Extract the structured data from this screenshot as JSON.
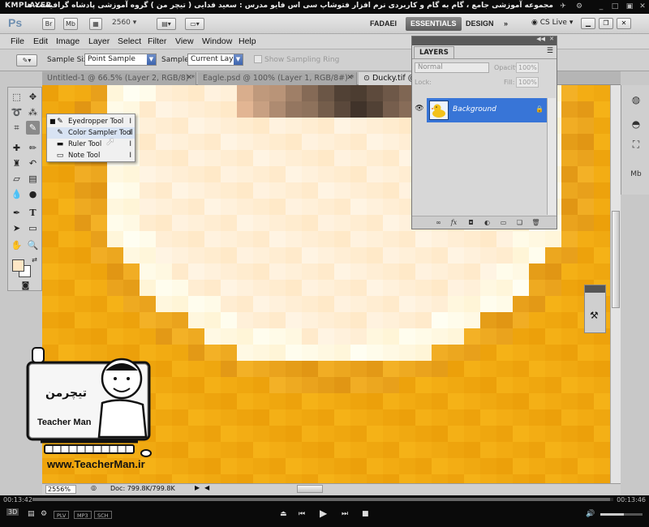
{
  "player": {
    "name": "KMPLAYER",
    "video_title": "مجموعه آموزشی جامع ، گام به گام و کاربردی نرم افزار فتوشاپ سی اس فایو   مدرس : سعید فدایی ( تیچر من ) گروه آموزشی پادشاه گرافیست ها",
    "time_current": "00:13:42",
    "time_total": "00:13:46",
    "progress_fraction": 0.995,
    "volume_fraction": 0.55,
    "tags": [
      "PLV",
      "MP3",
      "SCH"
    ],
    "badge_3d": "3D"
  },
  "ps": {
    "logo": "Ps",
    "appbar_icons": [
      "Br",
      "Mb"
    ],
    "zoom_level": "2560",
    "workspaces": [
      "FADAEI",
      "ESSENTIALS",
      "DESIGN"
    ],
    "more_workspaces": "»",
    "cs_live": "CS Live",
    "menus": [
      "File",
      "Edit",
      "Image",
      "Layer",
      "Select",
      "Filter",
      "View",
      "Window",
      "Help"
    ],
    "options": {
      "sample_size_label": "Sample Size:",
      "sample_size_value": "Point Sample",
      "sample_label": "Sample:",
      "sample_value": "Current Layer",
      "show_ring_label": "Show Sampling Ring"
    },
    "tabs": [
      {
        "label": "Untitled-1 @ 66.5% (Layer 2, RGB/8) *",
        "active": false
      },
      {
        "label": "Eagle.psd @ 100% (Layer 1, RGB/8#) *",
        "active": false
      },
      {
        "label": "Ducky.tif @",
        "active": true
      }
    ],
    "flyout": [
      {
        "label": "Eyedropper Tool",
        "shortcut": "I",
        "current": true
      },
      {
        "label": "Color Sampler Tool",
        "shortcut": "I",
        "current": false
      },
      {
        "label": "Ruler Tool",
        "shortcut": "I",
        "current": false
      },
      {
        "label": "Note Tool",
        "shortcut": "I",
        "current": false
      }
    ],
    "status": {
      "zoom": "2556%",
      "doc_size": "Doc: 799.8K/799.8K"
    },
    "layers": {
      "tab_label": "LAYERS",
      "blend_mode": "Normal",
      "opacity_label": "Opacity:",
      "opacity_value": "100%",
      "lock_label": "Lock:",
      "fill_label": "Fill:",
      "fill_value": "100%",
      "layer_name": "Background"
    }
  },
  "watermark": {
    "logo_title": "تیچرمن",
    "logo_subtitle": "Teacher Man",
    "url": "www.TeacherMan.ir"
  },
  "colors": {
    "canvas_orange": "#f0a410",
    "layer_selected": "#3875d7",
    "foreground_swatch": "#fde6c5"
  }
}
